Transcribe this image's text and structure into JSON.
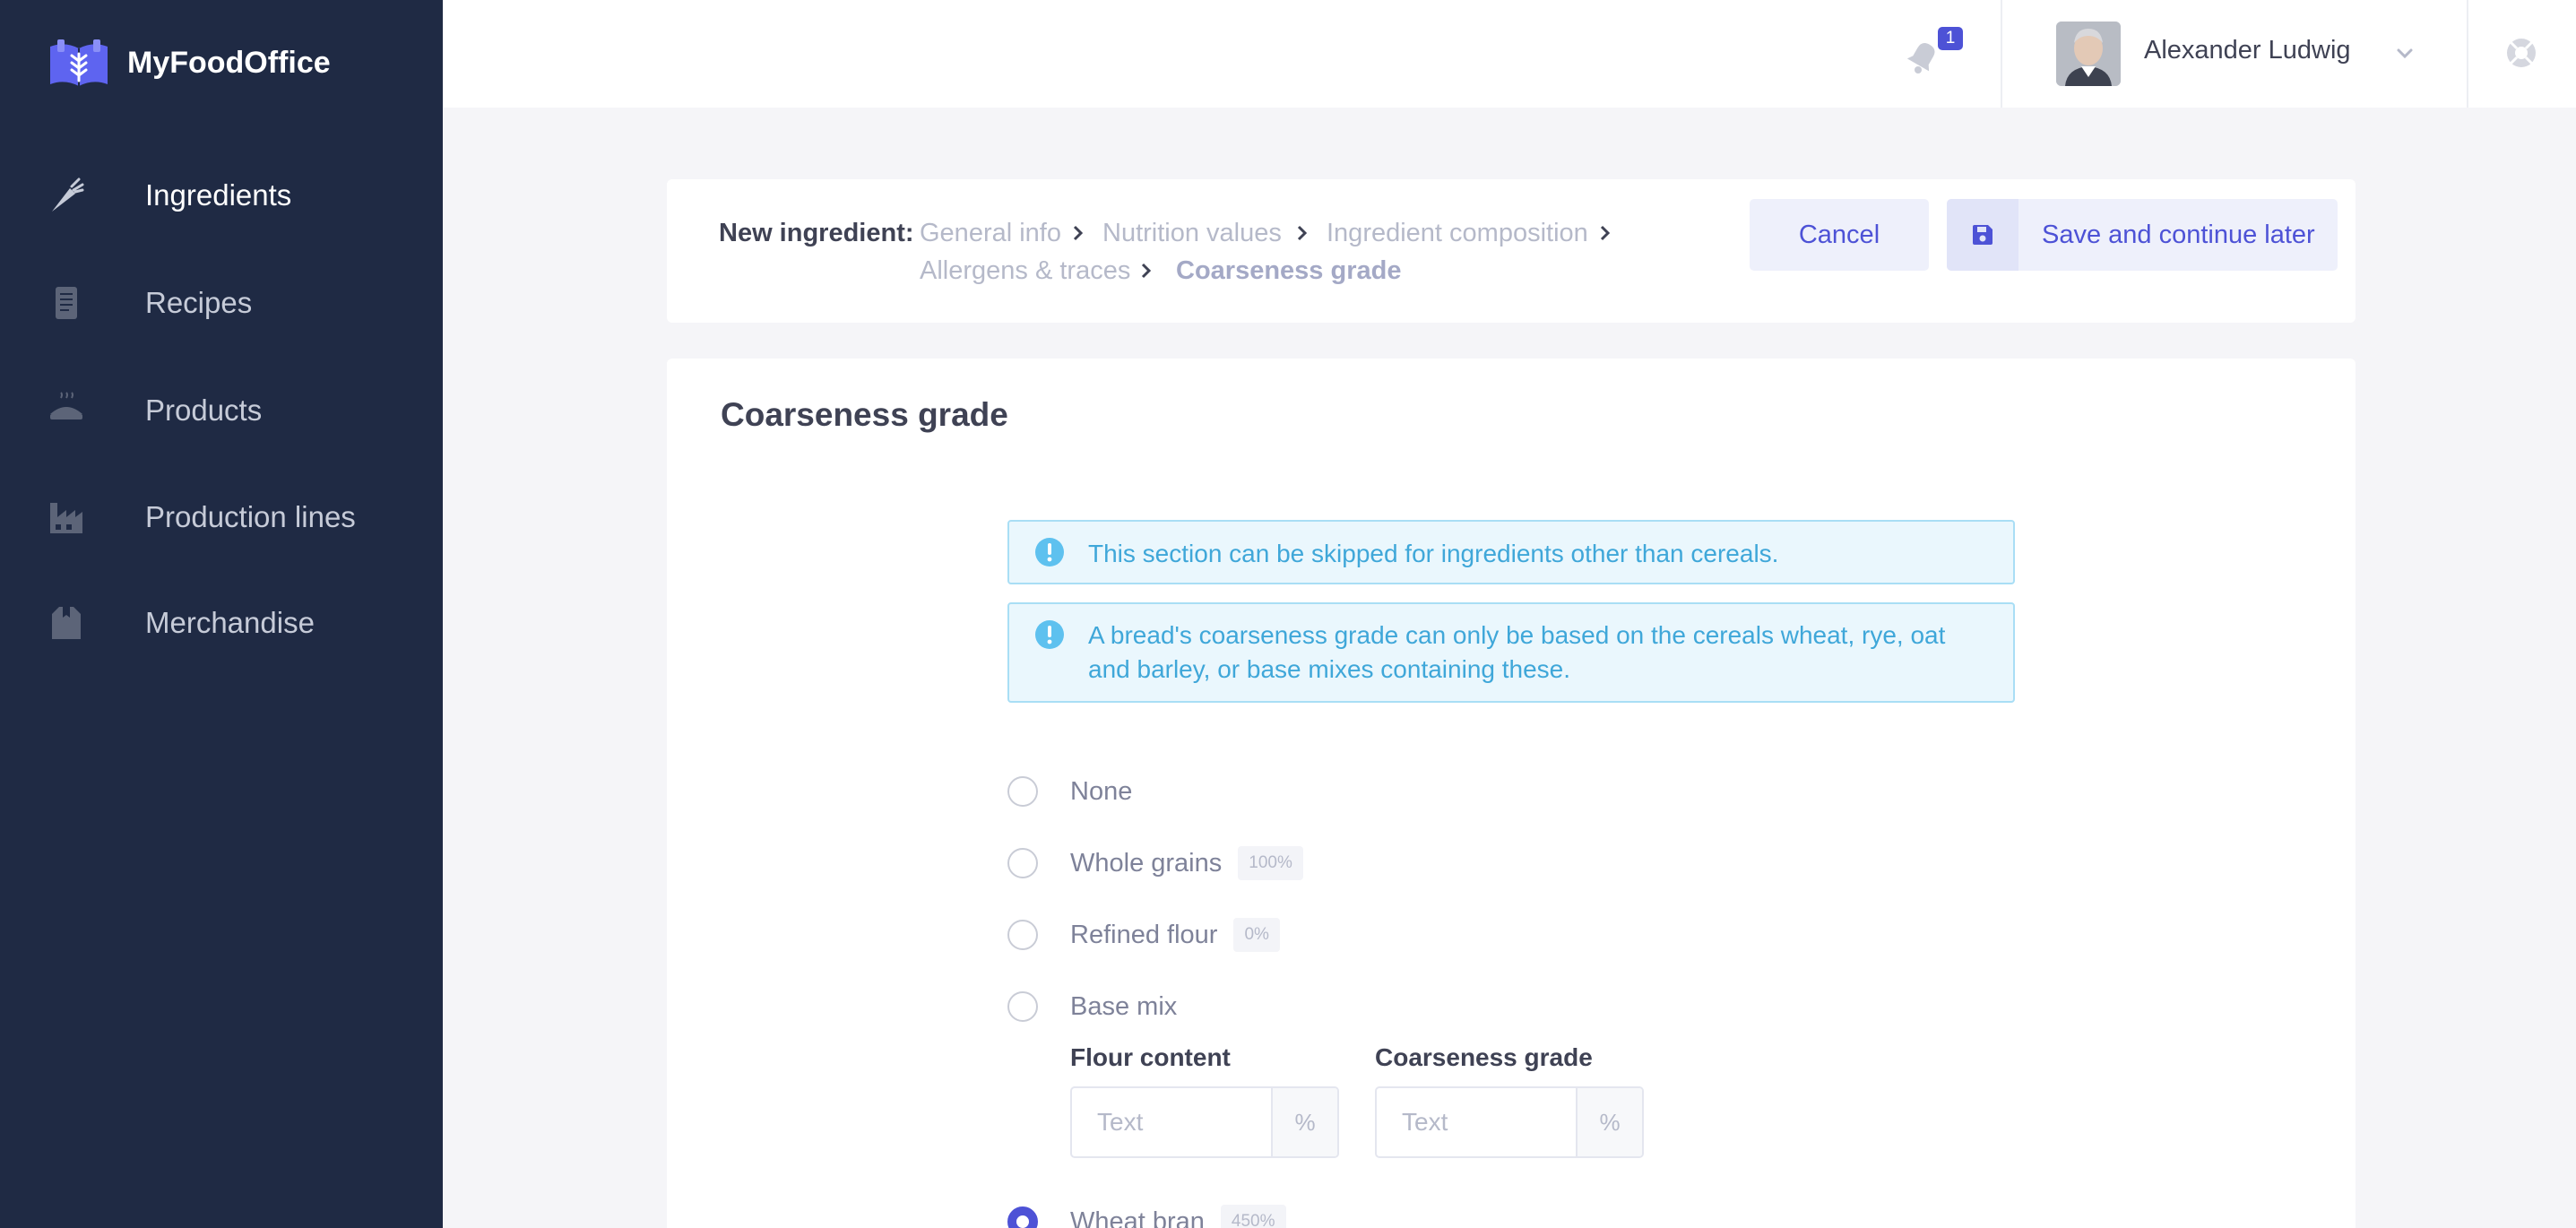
{
  "app": {
    "name": "MyFoodOffice"
  },
  "sidebar": {
    "items": [
      {
        "label": "Ingredients",
        "icon": "carrot-icon",
        "active": true
      },
      {
        "label": "Recipes",
        "icon": "recipe-book-icon",
        "active": false
      },
      {
        "label": "Products",
        "icon": "pie-icon",
        "active": false
      },
      {
        "label": "Production lines",
        "icon": "factory-icon",
        "active": false
      },
      {
        "label": "Merchandise",
        "icon": "box-icon",
        "active": false
      }
    ]
  },
  "header": {
    "notifications": {
      "count": "1",
      "icon": "bell-icon"
    },
    "user": {
      "name": "Alexander Ludwig"
    },
    "help_icon": "lifebuoy-icon"
  },
  "breadcrumb": {
    "title": "New ingredient:",
    "steps": [
      "General info",
      "Nutrition values",
      "Ingredient composition",
      "Allergens & traces",
      "Coarseness grade"
    ],
    "current_index": 4
  },
  "actions": {
    "cancel": "Cancel",
    "save": "Save and continue later"
  },
  "section": {
    "title": "Coarseness grade",
    "alerts": [
      "This section can be skipped for ingredients other than cereals.",
      "A bread's coarseness grade can only be based on the cereals wheat, rye, oat and barley, or base mixes containing these."
    ],
    "options": [
      {
        "label": "None",
        "badge": "",
        "checked": false
      },
      {
        "label": "Whole grains",
        "badge": "100%",
        "checked": false
      },
      {
        "label": "Refined flour",
        "badge": "0%",
        "checked": false
      },
      {
        "label": "Base mix",
        "badge": "",
        "checked": false
      },
      {
        "label": "Wheat bran",
        "badge": "450%",
        "checked": true
      }
    ],
    "base_mix_fields": [
      {
        "label": "Flour content",
        "placeholder": "Text",
        "unit": "%"
      },
      {
        "label": "Coarseness grade",
        "placeholder": "Text",
        "unit": "%"
      }
    ]
  },
  "colors": {
    "sidebar": "#1f2a44",
    "accent": "#4d52d6",
    "info": "#3fa7d9"
  }
}
